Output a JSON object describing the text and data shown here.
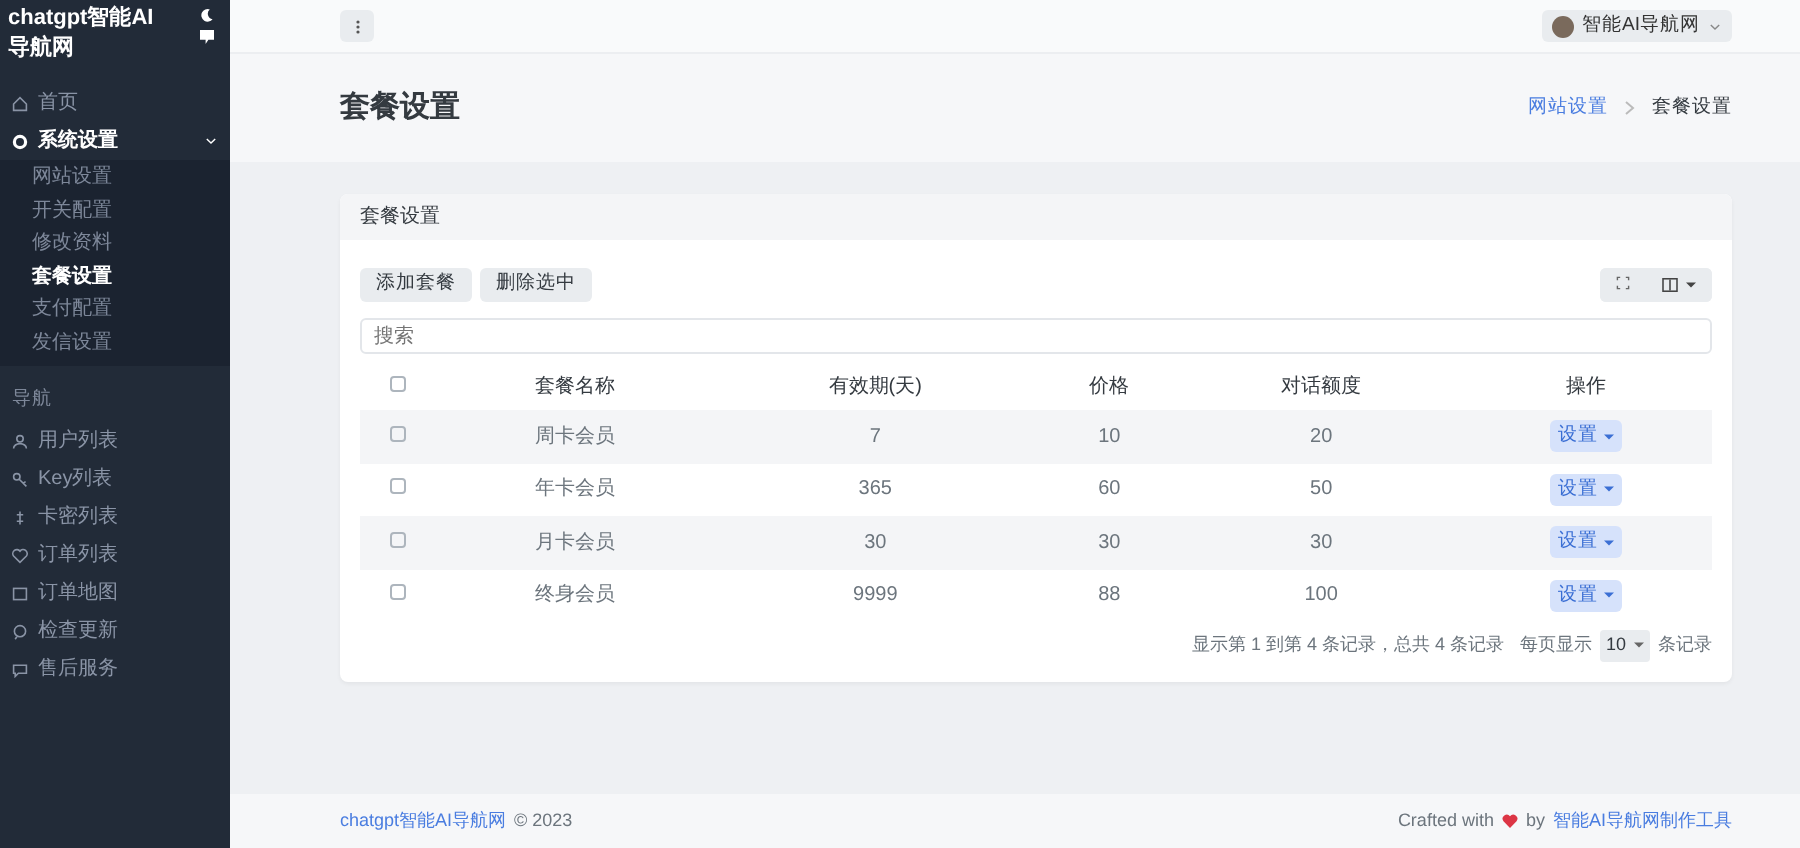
{
  "sidebar": {
    "brand": "chatgpt智能AI导航网",
    "menu": [
      {
        "label": "首页",
        "selected": false
      },
      {
        "label": "系统设置",
        "selected": true,
        "expanded": true,
        "children": [
          {
            "label": "网站设置",
            "selected": false
          },
          {
            "label": "开关配置",
            "selected": false
          },
          {
            "label": "修改资料",
            "selected": false
          },
          {
            "label": "套餐设置",
            "selected": true
          },
          {
            "label": "支付配置",
            "selected": false
          },
          {
            "label": "发信设置",
            "selected": false
          }
        ]
      }
    ],
    "section_title": "导航",
    "nav": [
      {
        "label": "用户列表",
        "selected": false
      },
      {
        "label": "Key列表",
        "selected": false
      },
      {
        "label": "卡密列表",
        "selected": false
      },
      {
        "label": "订单列表",
        "selected": false
      },
      {
        "label": "订单地图",
        "selected": false
      },
      {
        "label": "检查更新",
        "selected": false
      },
      {
        "label": "售后服务",
        "selected": false
      }
    ]
  },
  "topbar": {
    "user": "智能AI导航网"
  },
  "page_header": {
    "title": "套餐设置",
    "breadcrumb": [
      {
        "label": "网站设置",
        "selected": false
      },
      {
        "label": "套餐设置",
        "selected": true
      }
    ]
  },
  "card": {
    "title": "套餐设置",
    "buttons": [
      "添加套餐",
      "删除选中"
    ],
    "search": {
      "placeholder": "搜索"
    },
    "table": {
      "columns": [
        "套餐名称",
        "有效期(天)",
        "价格",
        "对话额度",
        "操作"
      ],
      "header_checked": false,
      "rows": [
        {
          "checked": false,
          "cells": [
            "周卡会员",
            "7",
            "10",
            "20"
          ],
          "action": "设置"
        },
        {
          "checked": false,
          "cells": [
            "年卡会员",
            "365",
            "60",
            "50"
          ],
          "action": "设置"
        },
        {
          "checked": false,
          "cells": [
            "月卡会员",
            "30",
            "30",
            "30"
          ],
          "action": "设置"
        },
        {
          "checked": false,
          "cells": [
            "终身会员",
            "9999",
            "88",
            "100"
          ],
          "action": "设置"
        }
      ]
    },
    "pagination": {
      "summary": "显示第 1 到第 4 条记录，总共 4 条记录",
      "per_page_label": "每页显示",
      "per_page": "10",
      "per_page_suffix": "条记录"
    }
  },
  "footer": {
    "left_link": "chatgpt智能AI导航网",
    "left_text": "© 2023",
    "crafted": "Crafted with",
    "by": "by",
    "right_link": "智能AI导航网制作工具"
  }
}
